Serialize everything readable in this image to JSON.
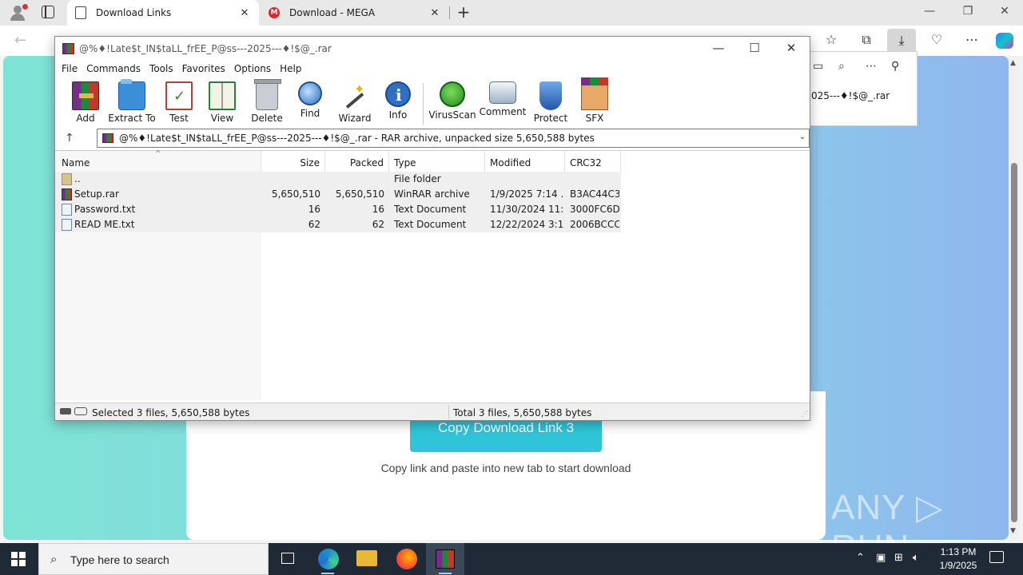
{
  "browser": {
    "tabs": [
      {
        "title": "Download Links",
        "close": "✕"
      },
      {
        "title": "Download - MEGA",
        "close": "✕"
      }
    ],
    "newtab_glyph": "+",
    "window_controls": {
      "minimize": "—",
      "restore": "❐",
      "close": "✕"
    },
    "toolbar_icons": [
      "back-icon",
      "refresh-icon",
      "favorites-icon",
      "collections-icon",
      "downloads-icon",
      "browser-essentials-icon",
      "more-icon",
      "copilot-icon"
    ]
  },
  "downloads_panel": {
    "visible_filename": "025---♦!$@_.rar",
    "icons": [
      "open-folder-icon",
      "search-icon",
      "more-icon",
      "pin-icon"
    ]
  },
  "page": {
    "button_label": "Copy Download Link 3",
    "hint": "Copy link and paste into new tab to start download",
    "watermark": "ANY ▷ RUN",
    "colors": {
      "button": "#2fc4d8",
      "gradient_start": "#7de3d4",
      "gradient_end": "#8fb7ee"
    }
  },
  "winrar": {
    "title": "@%♦!Late$t_IN$taLL_frEE_P@ss---2025---♦!$@_.rar",
    "menu": [
      "File",
      "Commands",
      "Tools",
      "Favorites",
      "Options",
      "Help"
    ],
    "tools": [
      {
        "label": "Add",
        "icon": "add-icon"
      },
      {
        "label": "Extract To",
        "icon": "extract-icon"
      },
      {
        "label": "Test",
        "icon": "test-icon"
      },
      {
        "label": "View",
        "icon": "view-icon"
      },
      {
        "label": "Delete",
        "icon": "delete-icon"
      },
      {
        "label": "Find",
        "icon": "find-icon"
      },
      {
        "label": "Wizard",
        "icon": "wizard-icon"
      },
      {
        "label": "Info",
        "icon": "info-icon"
      },
      {
        "label": "VirusScan",
        "icon": "virusscan-icon"
      },
      {
        "label": "Comment",
        "icon": "comment-icon"
      },
      {
        "label": "Protect",
        "icon": "protect-icon"
      },
      {
        "label": "SFX",
        "icon": "sfx-icon"
      }
    ],
    "address": "@%♦!Late$t_IN$taLL_frEE_P@ss---2025---♦!$@_.rar - RAR archive, unpacked size 5,650,588 bytes",
    "columns": [
      "Name",
      "Size",
      "Packed",
      "Type",
      "Modified",
      "CRC32"
    ],
    "files": [
      {
        "name": "..",
        "size": "",
        "packed": "",
        "type": "File folder",
        "modified": "",
        "crc": "",
        "kind": "folder"
      },
      {
        "name": "Setup.rar",
        "size": "5,650,510",
        "packed": "5,650,510",
        "type": "WinRAR archive",
        "modified": "1/9/2025 7:14 ...",
        "crc": "B3AC44C3",
        "kind": "rar"
      },
      {
        "name": "Password.txt",
        "size": "16",
        "packed": "16",
        "type": "Text Document",
        "modified": "11/30/2024 11:...",
        "crc": "3000FC6D",
        "kind": "txt"
      },
      {
        "name": "READ ME.txt",
        "size": "62",
        "packed": "62",
        "type": "Text Document",
        "modified": "12/22/2024 3:1...",
        "crc": "2006BCCC",
        "kind": "txt"
      }
    ],
    "status_left": "Selected 3 files, 5,650,588 bytes",
    "status_right": "Total 3 files, 5,650,588 bytes"
  },
  "taskbar": {
    "search_placeholder": "Type here to search",
    "time": "1:13 PM",
    "date": "1/9/2025",
    "apps": [
      "task-view",
      "edge",
      "file-explorer",
      "firefox",
      "winrar"
    ]
  }
}
